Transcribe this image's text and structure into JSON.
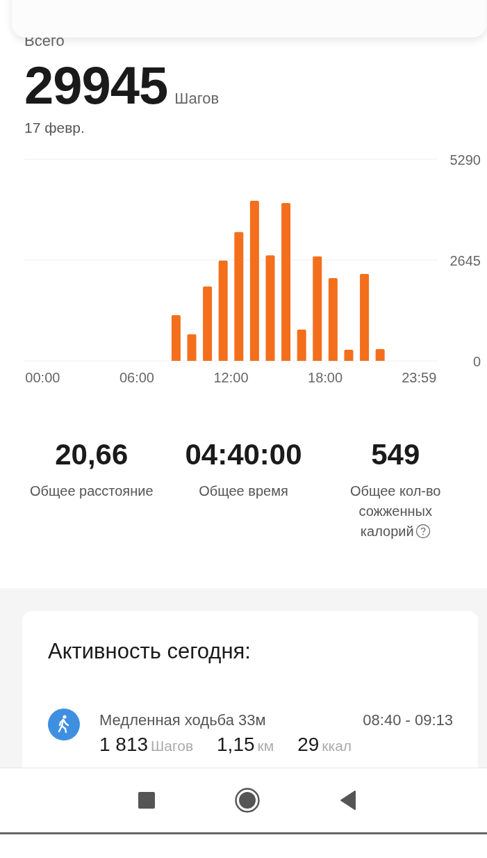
{
  "summary": {
    "label": "Всего",
    "total": "29945",
    "unit": "Шагов",
    "date": "17 февр."
  },
  "chart_data": {
    "type": "bar",
    "x": [
      510,
      570,
      630,
      690,
      750,
      810,
      870,
      930,
      990,
      1050,
      1110,
      1170,
      1230,
      1290
    ],
    "series": [
      {
        "color": "#f36f1c",
        "values": [
          1200,
          700,
          1950,
          2630,
          3380,
          4200,
          2770,
          4140,
          820,
          2740,
          2170,
          290,
          2280,
          310
        ]
      }
    ],
    "xlim": [
      -70,
      1510
    ],
    "ylim": [
      0,
      5290
    ],
    "yticks": [
      0,
      2645,
      5290
    ],
    "xticks": [
      {
        "value": 0,
        "label": "00:00"
      },
      {
        "value": 360,
        "label": "06:00"
      },
      {
        "value": 720,
        "label": "12:00"
      },
      {
        "value": 1080,
        "label": "18:00"
      },
      {
        "value": 1439,
        "label": "23:59"
      }
    ]
  },
  "stats": [
    {
      "value": "20,66",
      "label": "Общее расстояние",
      "help": false
    },
    {
      "value": "04:40:00",
      "label": "Общее время",
      "help": false
    },
    {
      "value": "549",
      "label": "Общее кол-во сожженных калорий",
      "help": true
    }
  ],
  "activity": {
    "title": "Активность сегодня:",
    "items": [
      {
        "name": "Медленная ходьба 33м",
        "time": "08:40 - 09:13",
        "metrics": [
          {
            "value": "1 813",
            "unit": "Шагов"
          },
          {
            "value": "1,15",
            "unit": "км"
          },
          {
            "value": "29",
            "unit": "ккал"
          }
        ]
      }
    ]
  }
}
